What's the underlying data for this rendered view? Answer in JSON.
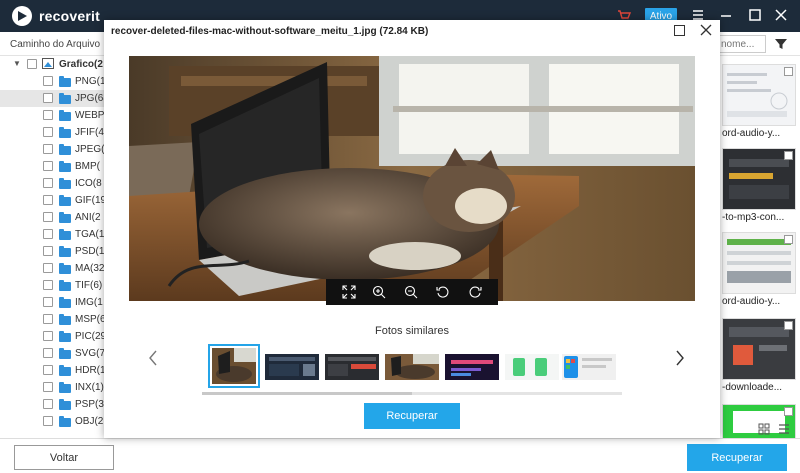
{
  "app": {
    "name": "recoverit",
    "badge": "Ativo"
  },
  "header": {
    "path_label": "Caminho do Arquivo",
    "search_placeholder": "nome..."
  },
  "sidebar": {
    "root": "Grafico(2",
    "items": [
      "PNG(1",
      "JPG(68",
      "WEBP",
      "JFIF(4",
      "JPEG(",
      "BMP(",
      "ICO(8",
      "GIF(19",
      "ANI(2",
      "TGA(1",
      "PSD(1",
      "MA(32",
      "TIF(6)",
      "IMG(1",
      "MSP(6",
      "PIC(29",
      "SVG(7",
      "HDR(1",
      "INX(1)",
      "PSP(3",
      "OBJ(2"
    ],
    "selected_index": 1
  },
  "right_strip": {
    "labels": [
      "ord-audio-y...",
      "-to-mp3-con...",
      "ord-audio-y...",
      "-downloade..."
    ]
  },
  "modal": {
    "title": "recover-deleted-files-mac-without-software_meitu_1.jpg (72.84  KB)",
    "similar_title": "Fotos similares",
    "recover_label": "Recuperar",
    "thumb_scroll_fraction": 0.5
  },
  "bottom": {
    "back_label": "Voltar",
    "recover_label": "Recuperar"
  },
  "colors": {
    "accent": "#23a6e9",
    "topbar": "#1d2b3a",
    "folder": "#2f8fd8"
  },
  "icons": {
    "viewer_toolbar": [
      "fit-screen-icon",
      "zoom-in-icon",
      "zoom-out-icon",
      "rotate-left-icon",
      "rotate-right-icon"
    ]
  }
}
